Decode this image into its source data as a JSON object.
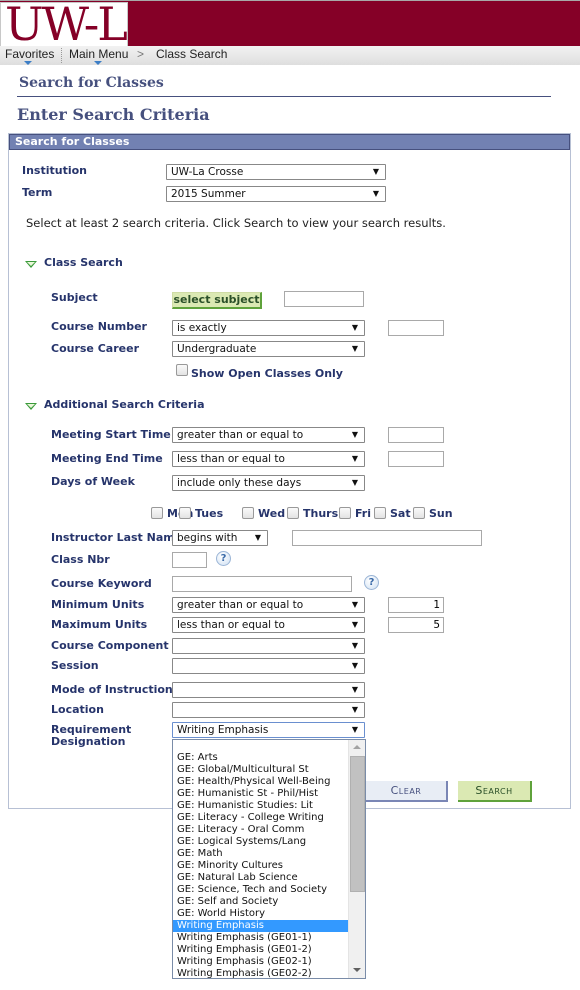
{
  "header": {
    "logo_text": "UW-L",
    "brand_color": "#850027",
    "nav": {
      "favorites": "Favorites",
      "main_menu": "Main Menu",
      "separator": ">",
      "current": "Class Search"
    }
  },
  "page": {
    "title": "Search for Classes",
    "subtitle": "Enter Search Criteria",
    "panel_title": "Search for Classes",
    "instructions": "Select at least 2 search criteria. Click Search to view your search results."
  },
  "fields": {
    "institution": {
      "label": "Institution",
      "value": "UW-La Crosse"
    },
    "term": {
      "label": "Term",
      "value": "2015 Summer"
    }
  },
  "class_search": {
    "section_label": "Class Search",
    "subject": {
      "label": "Subject",
      "button": "select subject",
      "value": ""
    },
    "course_number": {
      "label": "Course Number",
      "operator": "is exactly",
      "value": ""
    },
    "course_career": {
      "label": "Course Career",
      "value": "Undergraduate"
    },
    "open_only": {
      "label": "Show Open Classes Only",
      "checked": false
    }
  },
  "additional": {
    "section_label": "Additional Search Criteria",
    "meeting_start": {
      "label": "Meeting Start Time",
      "operator": "greater than or equal to",
      "value": ""
    },
    "meeting_end": {
      "label": "Meeting End Time",
      "operator": "less than or equal to",
      "value": ""
    },
    "days_of_week": {
      "label": "Days of Week",
      "operator": "include only these days"
    },
    "days": [
      {
        "label": "Mon",
        "checked": false
      },
      {
        "label": "Tues",
        "checked": false
      },
      {
        "label": "Wed",
        "checked": false
      },
      {
        "label": "Thurs",
        "checked": false
      },
      {
        "label": "Fri",
        "checked": false
      },
      {
        "label": "Sat",
        "checked": false
      },
      {
        "label": "Sun",
        "checked": false
      }
    ],
    "instructor": {
      "label": "Instructor Last Name",
      "operator": "begins with",
      "value": ""
    },
    "class_nbr": {
      "label": "Class Nbr",
      "value": "",
      "help": "?"
    },
    "keyword": {
      "label": "Course Keyword",
      "value": "",
      "help": "?"
    },
    "min_units": {
      "label": "Minimum Units",
      "operator": "greater than or equal to",
      "value": "1"
    },
    "max_units": {
      "label": "Maximum Units",
      "operator": "less than or equal to",
      "value": "5"
    },
    "course_component": {
      "label": "Course Component",
      "value": ""
    },
    "session": {
      "label": "Session",
      "value": ""
    },
    "mode": {
      "label": "Mode of Instruction",
      "value": ""
    },
    "location": {
      "label": "Location",
      "value": ""
    },
    "requirement": {
      "label_line1": "Requirement",
      "label_line2": "Designation",
      "value": "Writing Emphasis",
      "options": [
        "",
        "GE: Arts",
        "GE: Global/Multicultural St",
        "GE: Health/Physical Well-Being",
        "GE: Humanistic St - Phil/Hist",
        "GE: Humanistic Studies: Lit",
        "GE: Literacy - College Writing",
        "GE: Literacy - Oral Comm",
        "GE: Logical Systems/Lang",
        "GE: Math",
        "GE: Minority Cultures",
        "GE: Natural Lab Science",
        "GE: Science, Tech and Society",
        "GE: Self and Society",
        "GE: World History",
        "Writing Emphasis",
        "Writing Emphasis (GE01-1)",
        "Writing Emphasis (GE01-2)",
        "Writing Emphasis (GE02-1)",
        "Writing Emphasis (GE02-2)"
      ],
      "selected_index": 15
    }
  },
  "actions": {
    "clear": "Clear",
    "search": "Search"
  },
  "caret_glyph": "▼"
}
